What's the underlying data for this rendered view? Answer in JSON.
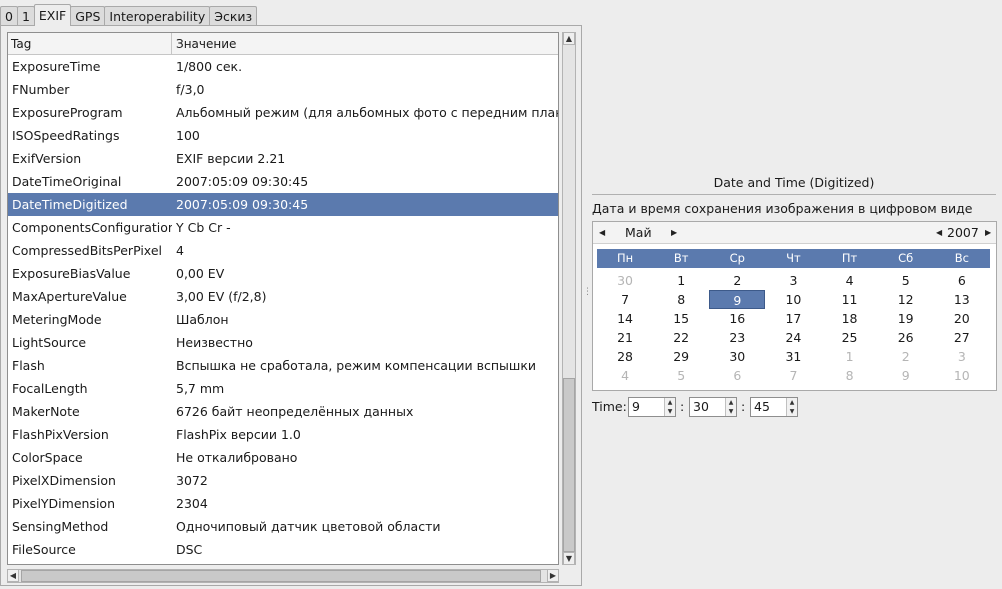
{
  "tabs": [
    "0",
    "1",
    "EXIF",
    "GPS",
    "Interoperability",
    "Эскиз"
  ],
  "table": {
    "headers": [
      "Tag",
      "Значение"
    ],
    "rows": [
      [
        "ExposureTime",
        "1/800 сек."
      ],
      [
        "FNumber",
        "f/3,0"
      ],
      [
        "ExposureProgram",
        "Альбомный режим (для альбомных фото с передним планом"
      ],
      [
        "ISOSpeedRatings",
        "100"
      ],
      [
        "ExifVersion",
        "EXIF версии 2.21"
      ],
      [
        "DateTimeOriginal",
        "2007:05:09 09:30:45"
      ],
      [
        "DateTimeDigitized",
        "2007:05:09 09:30:45"
      ],
      [
        "ComponentsConfiguration",
        "Y Cb Cr -"
      ],
      [
        "CompressedBitsPerPixel",
        " 4"
      ],
      [
        "ExposureBiasValue",
        "0,00 EV"
      ],
      [
        "MaxApertureValue",
        "3,00 EV (f/2,8)"
      ],
      [
        "MeteringMode",
        "Шаблон"
      ],
      [
        "LightSource",
        "Неизвестно"
      ],
      [
        "Flash",
        "Вспышка не сработала, режим компенсации вспышки"
      ],
      [
        "FocalLength",
        "5,7 mm"
      ],
      [
        "MakerNote",
        "6726 байт неопределённых данных"
      ],
      [
        "FlashPixVersion",
        "FlashPix версии 1.0"
      ],
      [
        "ColorSpace",
        "Не откалибровано"
      ],
      [
        "PixelXDimension",
        "3072"
      ],
      [
        "PixelYDimension",
        "2304"
      ],
      [
        "SensingMethod",
        "Одночиповый датчик цветовой области"
      ],
      [
        "FileSource",
        "DSC"
      ]
    ]
  },
  "detail": {
    "title": "Date and Time (Digitized)",
    "description": "Дата и время сохранения изображения в цифровом виде",
    "month": "Май",
    "year": "2007",
    "weekdays": [
      "Пн",
      "Вт",
      "Ср",
      "Чт",
      "Пт",
      "Сб",
      "Вс"
    ],
    "weeks": [
      [
        "30",
        "1",
        "2",
        "3",
        "4",
        "5",
        "6"
      ],
      [
        "7",
        "8",
        "9",
        "10",
        "11",
        "12",
        "13"
      ],
      [
        "14",
        "15",
        "16",
        "17",
        "18",
        "19",
        "20"
      ],
      [
        "21",
        "22",
        "23",
        "24",
        "25",
        "26",
        "27"
      ],
      [
        "28",
        "29",
        "30",
        "31",
        "1",
        "2",
        "3"
      ],
      [
        "4",
        "5",
        "6",
        "7",
        "8",
        "9",
        "10"
      ]
    ],
    "selected_day": "9",
    "time_label": "Time:",
    "hours": "9",
    "minutes": "30",
    "seconds": "45"
  },
  "colors": {
    "selection": "#5b7aae",
    "background": "#ededed"
  },
  "icons": {
    "spin_up": "▲",
    "spin_down": "▼",
    "left": "◀",
    "right": "▶"
  }
}
